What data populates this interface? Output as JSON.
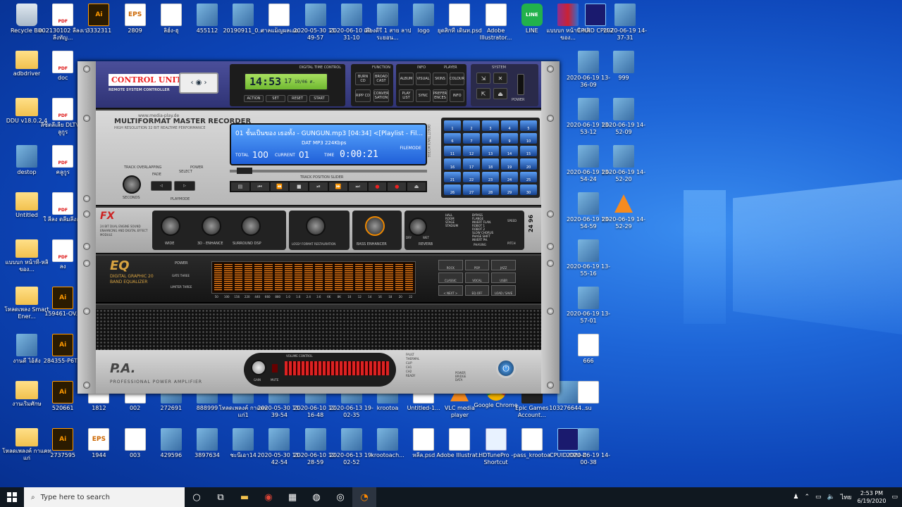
{
  "desktop_icons": [
    {
      "label": "Recycle Bin",
      "type": "bin",
      "col": 0,
      "row": 0
    },
    {
      "label": "002130102 ลีลงเวลีงทัญ...",
      "type": "pdf",
      "col": 1,
      "row": 0
    },
    {
      "label": "3332311",
      "type": "ai",
      "col": 2,
      "row": 0
    },
    {
      "label": "2809",
      "type": "eps",
      "col": 3,
      "row": 0
    },
    {
      "label": "ลิฮ์ง-ฮุ",
      "type": "doc",
      "col": 4,
      "row": 0
    },
    {
      "label": "455112",
      "type": "img",
      "col": 5,
      "row": 0
    },
    {
      "label": "20190911_0...",
      "type": "img",
      "col": 6,
      "row": 0
    },
    {
      "label": "ศาลแม็ญผลเงม",
      "type": "doc",
      "col": 7,
      "row": 0
    },
    {
      "label": "2020-05-30 11-49-57",
      "type": "img",
      "col": 8,
      "row": 0
    },
    {
      "label": "2020-06-10 12-31-10",
      "type": "img",
      "col": 9,
      "row": 0
    },
    {
      "label": "เสียงดีรี 1 สาย ลาประยอน...",
      "type": "img",
      "col": 10,
      "row": 0
    },
    {
      "label": "logo",
      "type": "img",
      "col": 11,
      "row": 0
    },
    {
      "label": "ยุดสิกที่ เดินท.psd",
      "type": "doc",
      "col": 12,
      "row": 0
    },
    {
      "label": "Adobe Illustrator...",
      "type": "doc",
      "col": 13,
      "row": 0
    },
    {
      "label": "LINE",
      "type": "line",
      "col": 14,
      "row": 0
    },
    {
      "label": "แบบบก หน้าที่-หลิ ของ...",
      "type": "rar",
      "col": 15,
      "row": 0
    },
    {
      "label": "CPUID CPU-Z",
      "type": "cpu",
      "col": 16,
      "row": 0
    },
    {
      "label": "2020-06-19 14-37-31",
      "type": "img",
      "col": 17,
      "row": 0
    },
    {
      "label": "adbdriver",
      "type": "folder",
      "col": 0,
      "row": 1
    },
    {
      "label": "doc",
      "type": "pdf",
      "col": 1,
      "row": 1
    },
    {
      "label": "DDU v18.0.2.4",
      "type": "folder",
      "col": 0,
      "row": 2
    },
    {
      "label": "ลีซิตลีเลีย DLTV คลูกูร",
      "type": "pdf",
      "col": 1,
      "row": 2
    },
    {
      "label": "destop",
      "type": "img",
      "col": 0,
      "row": 3
    },
    {
      "label": "คลูกูร",
      "type": "pdf",
      "col": 1,
      "row": 3
    },
    {
      "label": "Untitled",
      "type": "folder",
      "col": 0,
      "row": 4
    },
    {
      "label": "ใ ลีลง ดลีมลีงลง",
      "type": "pdf",
      "col": 1,
      "row": 4
    },
    {
      "label": "แบบบก หน้าที่-หลิ ของ...",
      "type": "folder",
      "col": 0,
      "row": 5
    },
    {
      "label": "ลง",
      "type": "pdf",
      "col": 1,
      "row": 5
    },
    {
      "label": "โหลดเพลง Smart Ener...",
      "type": "folder",
      "col": 0,
      "row": 6
    },
    {
      "label": "159461-OV...",
      "type": "ai",
      "col": 1,
      "row": 6
    },
    {
      "label": "งานดี ไอ้ลัง",
      "type": "img",
      "col": 0,
      "row": 7
    },
    {
      "label": "284355-P6T...",
      "type": "ai",
      "col": 1,
      "row": 7
    },
    {
      "label": "งานเริ่มศักษ",
      "type": "folder",
      "col": 0,
      "row": 8
    },
    {
      "label": "520661",
      "type": "ai",
      "col": 1,
      "row": 8
    },
    {
      "label": "1812",
      "type": "doc",
      "col": 2,
      "row": 8
    },
    {
      "label": "002",
      "type": "doc",
      "col": 3,
      "row": 8
    },
    {
      "label": "272691",
      "type": "img",
      "col": 4,
      "row": 8
    },
    {
      "label": "888999",
      "type": "img",
      "col": 5,
      "row": 8
    },
    {
      "label": "โหลดเพลงค์ กาแคทแก่1",
      "type": "img",
      "col": 6,
      "row": 8
    },
    {
      "label": "2020-05-30 11-39-54",
      "type": "img",
      "col": 7,
      "row": 8
    },
    {
      "label": "2020-06-10 12-16-48",
      "type": "img",
      "col": 8,
      "row": 8
    },
    {
      "label": "2020-06-13 19-02-35",
      "type": "img",
      "col": 9,
      "row": 8
    },
    {
      "label": "krootoa",
      "type": "img",
      "col": 10,
      "row": 8
    },
    {
      "label": "Untitled-1...",
      "type": "doc",
      "col": 11,
      "row": 8
    },
    {
      "label": "VLC media player",
      "type": "vlc",
      "col": 12,
      "row": 8
    },
    {
      "label": "Google Chrome",
      "type": "chrome",
      "col": 13,
      "row": 8
    },
    {
      "label": "Epic Games Account...",
      "type": "epic",
      "col": 14,
      "row": 8
    },
    {
      "label": "103276644...",
      "type": "img",
      "col": 15,
      "row": 8
    },
    {
      "label": "su",
      "type": "doc",
      "col": 16,
      "row": 8
    },
    {
      "label": "โหลดเพลงค์ กาแคทแก่",
      "type": "folder",
      "col": 0,
      "row": 9
    },
    {
      "label": "2737595",
      "type": "ai",
      "col": 1,
      "row": 9
    },
    {
      "label": "1944",
      "type": "eps",
      "col": 2,
      "row": 9
    },
    {
      "label": "003",
      "type": "doc",
      "col": 3,
      "row": 9
    },
    {
      "label": "429596",
      "type": "img",
      "col": 4,
      "row": 9
    },
    {
      "label": "3897634",
      "type": "img",
      "col": 5,
      "row": 9
    },
    {
      "label": "ชะนีเอา14",
      "type": "img",
      "col": 6,
      "row": 9
    },
    {
      "label": "2020-05-30 11-42-54",
      "type": "img",
      "col": 7,
      "row": 9
    },
    {
      "label": "2020-06-10 12-28-59",
      "type": "img",
      "col": 8,
      "row": 9
    },
    {
      "label": "2020-06-13 19-02-52",
      "type": "img",
      "col": 9,
      "row": 9
    },
    {
      "label": "krootoach...",
      "type": "img",
      "col": 10,
      "row": 9
    },
    {
      "label": "หลีล.psd",
      "type": "doc",
      "col": 11,
      "row": 9
    },
    {
      "label": "Adobe Illustrat...",
      "type": "doc",
      "col": 12,
      "row": 9
    },
    {
      "label": "HDTunePro - Shortcut",
      "type": "hd",
      "col": 13,
      "row": 9
    },
    {
      "label": "pass_krootoa",
      "type": "doc",
      "col": 14,
      "row": 9
    },
    {
      "label": "CPUID CPU-Z",
      "type": "cpu",
      "col": 15,
      "row": 9
    },
    {
      "label": "2020-06-19 14-00-38",
      "type": "img",
      "col": 16,
      "row": 9
    }
  ],
  "right_icons": [
    {
      "label": "2020-06-19 13-36-09",
      "type": "img",
      "col": 16,
      "row": 1
    },
    {
      "label": "999",
      "type": "img",
      "col": 17,
      "row": 1
    },
    {
      "label": "2020-06-19 13-53-12",
      "type": "img",
      "col": 16,
      "row": 2
    },
    {
      "label": "2020-06-19 14-52-09",
      "type": "img",
      "col": 17,
      "row": 2
    },
    {
      "label": "2020-06-19 13-54-24",
      "type": "img",
      "col": 16,
      "row": 3
    },
    {
      "label": "2020-06-19 14-52-20",
      "type": "img",
      "col": 17,
      "row": 3
    },
    {
      "label": "2020-06-19 13-54-59",
      "type": "img",
      "col": 16,
      "row": 4
    },
    {
      "label": "2020-06-19 14-52-29",
      "type": "vlc",
      "col": 17,
      "row": 4
    },
    {
      "label": "2020-06-19 13-55-16",
      "type": "img",
      "col": 16,
      "row": 5
    },
    {
      "label": "2020-06-19 13-57-01",
      "type": "img",
      "col": 16,
      "row": 6
    },
    {
      "label": "666",
      "type": "doc",
      "col": 16,
      "row": 7
    }
  ],
  "app": {
    "brand": "CONTROL UNIT",
    "brand_sub": "REMOTE SYSTEM CONTROLLER",
    "time_label": "DIGITAL TIME CONTROL",
    "time": "14:53",
    "seconds": "17",
    "date": "19/06 ศ.",
    "time_buttons": [
      "ACTION",
      "SET",
      "RESET",
      "START"
    ],
    "function_label": "FUNCTION",
    "function_buttons": [
      "BURN CD",
      "BROAD CAST",
      "RIPP CD",
      "CONVER SATION"
    ],
    "info_label": "INFO",
    "player_label": "PLAYER",
    "info_buttons": [
      "ALBUM",
      "VISUAL",
      "SKINS",
      "COLOUR",
      "PLAY LIST",
      "SYNC",
      "PREFER ENCES",
      "INFO"
    ],
    "system_label": "SYSTEM",
    "power_label": "POWER",
    "recorder_title": "MULTIFORMAT MASTER RECORDER",
    "recorder_sub": "HIGH RESOLUTION 32 BIT REALTIME PERFORMANCE",
    "site": "www.media-play.de",
    "track_title": "01 ชั้นเป็นของ เธอทั้ง - GUNGUN.mp3  [04:34]    <[Playlist - Fil...",
    "format": "DAT  MP3 224Kbps",
    "total_label": "TOTAL",
    "total": "100",
    "current_label": "CURRENT",
    "current": "01",
    "time_field_label": "TIME",
    "elapsed": "0:00:21",
    "filemode": "FILEMODE",
    "slider_label": "TRACK POSITION SLIDER",
    "fade": "FADE",
    "seconds_label": "SECONDS",
    "select": "SELECT",
    "playmode": "PLAYMODE",
    "track_overlapping": "TRACK OVERLAPPING",
    "power_small": "POWER",
    "grid_label": "DIRECT TRACK ACCESS",
    "fx_title": "FX",
    "fx_sub": "24 BIT DUAL ENGINE SOUND ENHANCING AND DIGITAL EFFECT MODULE",
    "fx_knobs": [
      "WIDE",
      "3D - ENHANCE",
      "SURROUND DSP",
      "LOSSY FORMAT RESTAURATION",
      "BASS ENHANCER",
      "REVERB"
    ],
    "fx_dry": "DRY",
    "fx_wet": "WET",
    "reverb_list": [
      "HALL",
      "ROOM",
      "STAGE",
      "STADIUM"
    ],
    "phasing_list": [
      "BYPASS",
      "FLANGE",
      "INVERT FLAN.",
      "ROBOT 1",
      "ROBOT 2",
      "SLOW CHORUS",
      "PHASE SHIFT",
      "INVERT PH."
    ],
    "phasing": "PHASING",
    "speed": "SPEED",
    "pitch": "PITCH",
    "fx_badge": "24 96",
    "eq_title": "EQ",
    "eq_sub": "DIGITAL GRAPHIC 20 BAND EQUALIZER",
    "eq_power": "POWER",
    "eq_gate": "GATE THREE",
    "eq_limiter": "LIMITER THREE",
    "eq_freqs": [
      "50",
      "100",
      "156",
      "220",
      "440",
      "660",
      "880",
      "1.0",
      "1.6",
      "2.4",
      "3.6",
      "6K",
      "8K",
      "10",
      "12",
      "14",
      "16",
      "18",
      "20",
      "22"
    ],
    "eq_presets": [
      "ROCK",
      "POP",
      "JAZZ",
      "CLASSIC",
      "VOCAL",
      "USER",
      "< NEXT >",
      "EQ-OFF",
      "LOAD / SAVE"
    ],
    "pa_title": "P.A.",
    "pa_sub": "PROFESSIONAL POWER AMPLIFIER",
    "volume_label": "VOLUME CONTROL",
    "gain": "GAIN",
    "mute": "MUTE",
    "fault": "FAULT",
    "thermal": "THERMAL",
    "clip": "CLIP",
    "ch1": "CH1",
    "ch2": "CH2",
    "ready": "READY",
    "pa_power": "POWER",
    "bridge": "BRIDGE",
    "data": "DATA"
  },
  "taskbar": {
    "search_placeholder": "Type here to search",
    "lang": "ไทย",
    "time": "2:53 PM",
    "date": "6/19/2020"
  }
}
